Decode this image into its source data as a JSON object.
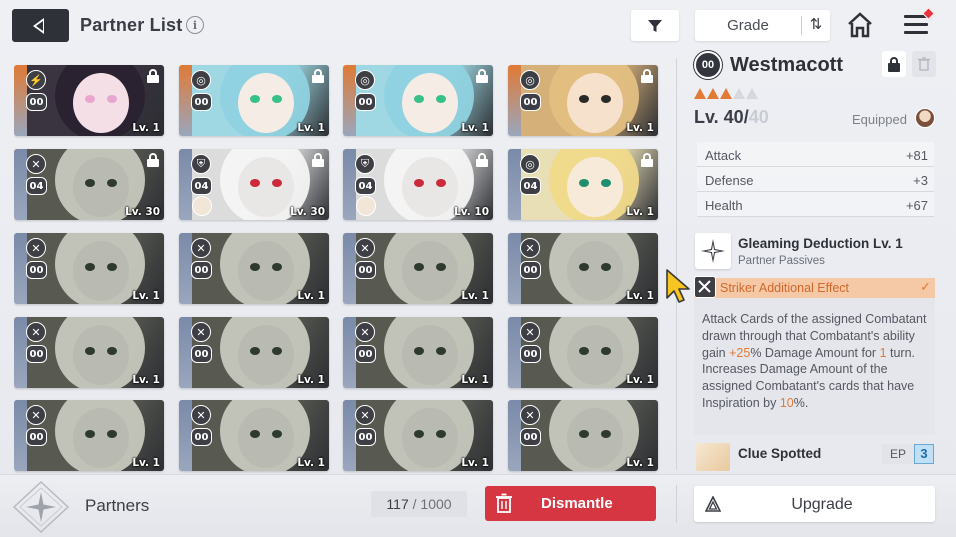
{
  "header": {
    "title": "Partner List",
    "info_glyph": "i",
    "sort_label": "Grade",
    "sort_glyph": "⇅"
  },
  "cards": [
    {
      "cls": "⚡",
      "lv_badge": "00",
      "level": "Lv. 1",
      "locked": true,
      "strip": "#e07a36",
      "bg": "#3a3340",
      "hair": "#2a2230",
      "skin": "#f4dfe6",
      "accent": "#e9a6d0"
    },
    {
      "cls": "◎",
      "lv_badge": "00",
      "level": "Lv. 1",
      "locked": true,
      "strip": "#e07a36",
      "bg": "#9fd7e2",
      "hair": "#8fd2e0",
      "skin": "#f6ece6",
      "accent": "#36c08a"
    },
    {
      "cls": "◎",
      "lv_badge": "00",
      "level": "Lv. 1",
      "locked": true,
      "strip": "#e07a36",
      "bg": "#9fd7e2",
      "hair": "#8fd2e0",
      "skin": "#f6ece6",
      "accent": "#36c08a"
    },
    {
      "cls": "◎",
      "lv_badge": "00",
      "level": "Lv. 1",
      "locked": true,
      "strip": "#e07a36",
      "bg": "#d6b079",
      "hair": "#e3bf82",
      "skin": "#f6e1cd",
      "accent": "#2a2a2a"
    },
    {
      "cls": "✕",
      "lv_badge": "04",
      "level": "Lv. 30",
      "locked": true,
      "strip": "#7a8aa8",
      "bg": "#585a52",
      "hair": "#c7c9be",
      "skin": "#b9bbb2",
      "accent": "#2d3a2c"
    },
    {
      "cls": "⛨",
      "lv_badge": "04",
      "level": "Lv. 30",
      "locked": true,
      "strip": "#7a8aa8",
      "bg": "#dcdcdc",
      "hair": "#f4f4f4",
      "skin": "#e9e6e6",
      "accent": "#cc2a3a",
      "equip": true
    },
    {
      "cls": "⛨",
      "lv_badge": "04",
      "level": "Lv. 10",
      "locked": true,
      "strip": "#7a8aa8",
      "bg": "#dcdcdc",
      "hair": "#f4f4f4",
      "skin": "#e9e6e6",
      "accent": "#cc2a3a",
      "equip": true
    },
    {
      "cls": "◎",
      "lv_badge": "04",
      "level": "Lv. 1",
      "locked": true,
      "strip": "#7a8aa8",
      "bg": "#e9dfb6",
      "hair": "#f0d98a",
      "skin": "#f8ead9",
      "accent": "#1f8f6f"
    },
    {
      "cls": "✕",
      "lv_badge": "00",
      "level": "Lv. 1",
      "locked": false,
      "strip": "#7a8aa8",
      "bg": "#585a52",
      "hair": "#c7c9be",
      "skin": "#b9bbb2",
      "accent": "#2d3a2c"
    },
    {
      "cls": "✕",
      "lv_badge": "00",
      "level": "Lv. 1",
      "locked": false,
      "strip": "#7a8aa8",
      "bg": "#585a52",
      "hair": "#c7c9be",
      "skin": "#b9bbb2",
      "accent": "#2d3a2c"
    },
    {
      "cls": "✕",
      "lv_badge": "00",
      "level": "Lv. 1",
      "locked": false,
      "strip": "#7a8aa8",
      "bg": "#585a52",
      "hair": "#c7c9be",
      "skin": "#b9bbb2",
      "accent": "#2d3a2c"
    },
    {
      "cls": "✕",
      "lv_badge": "00",
      "level": "Lv. 1",
      "locked": false,
      "strip": "#7a8aa8",
      "bg": "#585a52",
      "hair": "#c7c9be",
      "skin": "#b9bbb2",
      "accent": "#2d3a2c"
    },
    {
      "cls": "✕",
      "lv_badge": "00",
      "level": "Lv. 1",
      "locked": false,
      "strip": "#7a8aa8",
      "bg": "#585a52",
      "hair": "#c7c9be",
      "skin": "#b9bbb2",
      "accent": "#2d3a2c"
    },
    {
      "cls": "✕",
      "lv_badge": "00",
      "level": "Lv. 1",
      "locked": false,
      "strip": "#7a8aa8",
      "bg": "#585a52",
      "hair": "#c7c9be",
      "skin": "#b9bbb2",
      "accent": "#2d3a2c"
    },
    {
      "cls": "✕",
      "lv_badge": "00",
      "level": "Lv. 1",
      "locked": false,
      "strip": "#7a8aa8",
      "bg": "#585a52",
      "hair": "#c7c9be",
      "skin": "#b9bbb2",
      "accent": "#2d3a2c"
    },
    {
      "cls": "✕",
      "lv_badge": "00",
      "level": "Lv. 1",
      "locked": false,
      "strip": "#7a8aa8",
      "bg": "#585a52",
      "hair": "#c7c9be",
      "skin": "#b9bbb2",
      "accent": "#2d3a2c"
    },
    {
      "cls": "✕",
      "lv_badge": "00",
      "level": "Lv. 1",
      "locked": false,
      "strip": "#7a8aa8",
      "bg": "#585a52",
      "hair": "#c7c9be",
      "skin": "#b9bbb2",
      "accent": "#2d3a2c"
    },
    {
      "cls": "✕",
      "lv_badge": "00",
      "level": "Lv. 1",
      "locked": false,
      "strip": "#7a8aa8",
      "bg": "#585a52",
      "hair": "#c7c9be",
      "skin": "#b9bbb2",
      "accent": "#2d3a2c"
    },
    {
      "cls": "✕",
      "lv_badge": "00",
      "level": "Lv. 1",
      "locked": false,
      "strip": "#7a8aa8",
      "bg": "#585a52",
      "hair": "#c7c9be",
      "skin": "#b9bbb2",
      "accent": "#2d3a2c"
    },
    {
      "cls": "✕",
      "lv_badge": "00",
      "level": "Lv. 1",
      "locked": false,
      "strip": "#7a8aa8",
      "bg": "#585a52",
      "hair": "#c7c9be",
      "skin": "#b9bbb2",
      "accent": "#2d3a2c"
    }
  ],
  "detail": {
    "grade_emblem": "00",
    "name": "Westmacott",
    "stars_total": 5,
    "stars_filled": 3,
    "level_current": "Lv. 40/",
    "level_max": "40",
    "equipped_label": "Equipped",
    "stats": [
      {
        "key": "Attack",
        "value": "+81"
      },
      {
        "key": "Defense",
        "value": "+3"
      },
      {
        "key": "Health",
        "value": "+67"
      }
    ],
    "skill_name": "Gleaming Deduction Lv. 1",
    "skill_sub": "Partner Passives",
    "effect_title": "Striker Additional Effect",
    "effect_check": "✓",
    "effect_desc": {
      "p1": "Attack Cards of the assigned Combatant drawn through that Combatant's ability gain ",
      "v1": "+25",
      "p2": "% Damage Amount for ",
      "v2": "1",
      "p3": " turn. Increases Damage Amount of the assigned Combatant's cards that have Inspiration by ",
      "v3": "10",
      "p4": "%."
    },
    "clue_name": "Clue Spotted",
    "clue_ep_label": "EP",
    "clue_ep_value": "3"
  },
  "footer": {
    "section_label": "Partners",
    "count_current": "117",
    "count_sep": " / ",
    "count_max": "1000",
    "dismantle_label": "Dismantle",
    "upgrade_label": "Upgrade"
  },
  "colors": {
    "accent_orange": "#e07a36",
    "dismantle_red": "#d63642",
    "dark": "#2f3138"
  }
}
